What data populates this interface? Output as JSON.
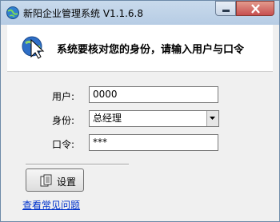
{
  "window": {
    "title": "新阳企业管理系统 V1.1.6.8"
  },
  "header": {
    "message": "系统要核对您的身份，请输入用户与口令"
  },
  "form": {
    "user_label": "用户:",
    "user_value": "0000",
    "role_label": "身份:",
    "role_value": "总经理",
    "password_label": "口令:",
    "password_value": "***"
  },
  "actions": {
    "settings_label": "设置",
    "faq_link": "查看常见问题"
  },
  "icons": {
    "app": "globe-icon",
    "header": "cursor-arrow-icon",
    "settings": "document-icon",
    "minimize": "minimize-icon",
    "close": "close-icon",
    "dropdown": "chevron-down-icon"
  },
  "colors": {
    "titlebar": "#b6cce4",
    "close_button": "#c75050",
    "link": "#0033cc"
  }
}
